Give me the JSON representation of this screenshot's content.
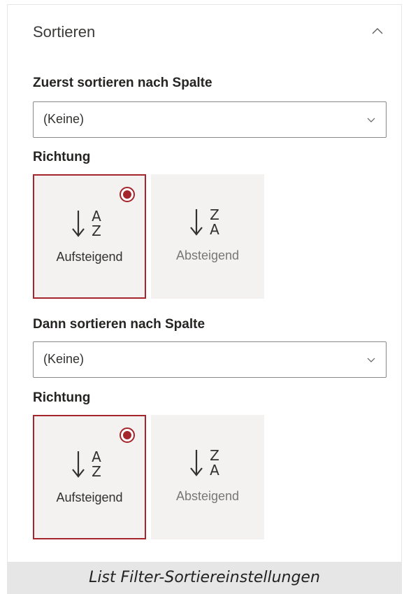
{
  "panel": {
    "section_title": "Sortieren"
  },
  "first_sort": {
    "column_label": "Zuerst sortieren nach Spalte",
    "column_value": "(Keine)",
    "direction_label": "Richtung",
    "ascending_label": "Aufsteigend",
    "descending_label": "Absteigend",
    "selected": "ascending"
  },
  "second_sort": {
    "column_label": "Dann sortieren nach Spalte",
    "column_value": "(Keine)",
    "direction_label": "Richtung",
    "ascending_label": "Aufsteigend",
    "descending_label": "Absteigend",
    "selected": "ascending"
  },
  "glyphs": {
    "ascending_top": "A",
    "ascending_bottom": "Z",
    "descending_top": "Z",
    "descending_bottom": "A"
  },
  "caption": "List Filter-Sortiereinstellungen",
  "colors": {
    "accent": "#a4262c",
    "tile_bg": "#f3f2f1"
  },
  "icons": {
    "collapse": "chevron-up-icon",
    "dropdown": "chevron-down-icon",
    "ascending": "sort-ascending-icon",
    "descending": "sort-descending-icon"
  }
}
